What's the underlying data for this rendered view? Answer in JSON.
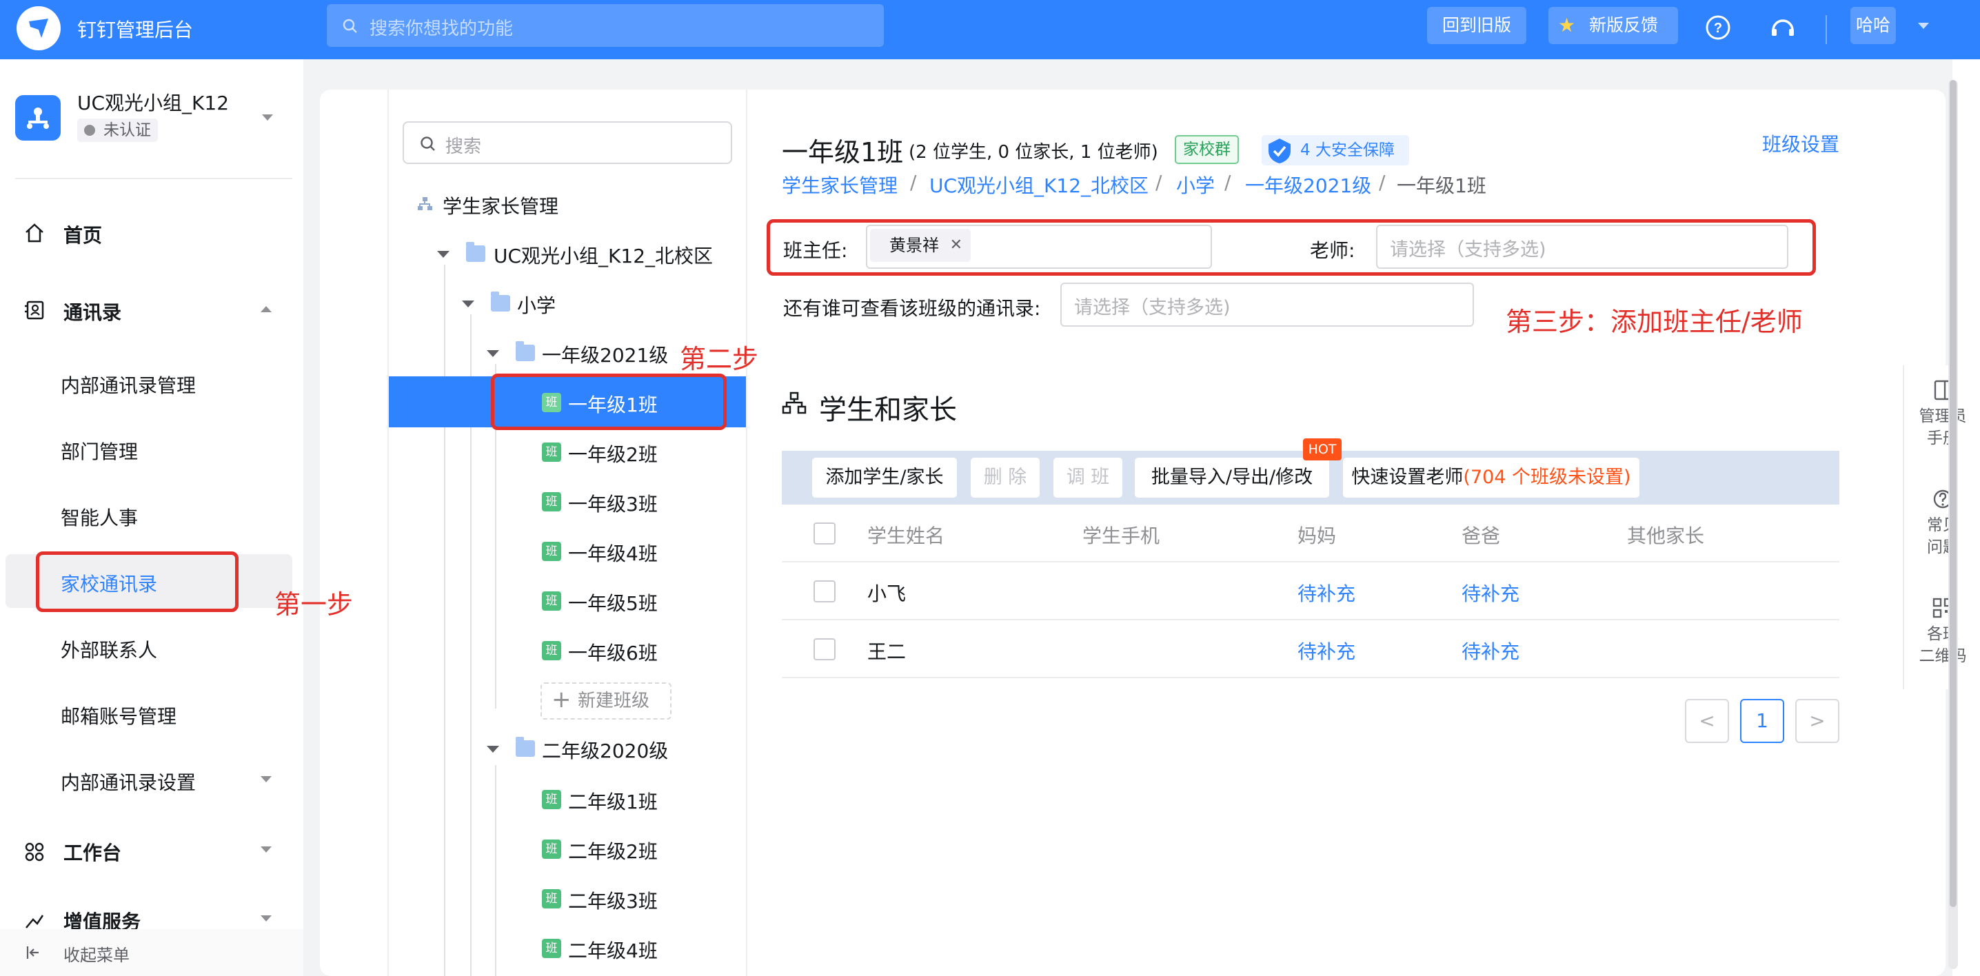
{
  "header": {
    "title": "钉钉管理后台",
    "search_placeholder": "搜索你想找的功能",
    "old_version": "回到旧版",
    "feedback": "新版反馈",
    "user": "哈哈"
  },
  "org": {
    "name": "UC观光小组_K12",
    "status": "未认证"
  },
  "sidebar": {
    "home": "首页",
    "contacts": "通讯录",
    "items": [
      "内部通讯录管理",
      "部门管理",
      "智能人事",
      "家校通讯录",
      "外部联系人",
      "邮箱账号管理",
      "内部通讯录设置"
    ],
    "workbench": "工作台",
    "value_added": "增值服务",
    "collapse": "收起菜单"
  },
  "annotations": {
    "step1": "第一步",
    "step2": "第二步",
    "step3": "第三步：添加班主任/老师"
  },
  "tree": {
    "search_placeholder": "搜索",
    "root": "学生家长管理",
    "campus": "UC观光小组_K12_北校区",
    "school": "小学",
    "grade1": "一年级2021级",
    "grade1_classes": [
      "一年级1班",
      "一年级2班",
      "一年级3班",
      "一年级4班",
      "一年级5班",
      "一年级6班"
    ],
    "new_class": "新建班级",
    "grade2": "二年级2020级",
    "grade2_classes": [
      "二年级1班",
      "二年级2班",
      "二年级3班",
      "二年级4班"
    ],
    "class_badge": "班"
  },
  "detail": {
    "title": "一年级1班",
    "subtitle": "(2 位学生, 0 位家长, 1 位老师)",
    "tag_group": "家校群",
    "tag_safety": "4 大安全保障",
    "settings": "班级设置",
    "breadcrumb": [
      "学生家长管理",
      "UC观光小组_K12_北校区",
      "小学",
      "一年级2021级",
      "一年级1班"
    ],
    "head_teacher_label": "班主任:",
    "head_teacher_value": "黄景祥",
    "teacher_label": "老师:",
    "teacher_placeholder": "请选择（支持多选)",
    "viewers_label": "还有谁可查看该班级的通讯录:",
    "viewers_placeholder": "请选择（支持多选)",
    "section_title": "学生和家长",
    "btn_add": "添加学生/家长",
    "btn_delete": "删 除",
    "btn_transfer": "调 班",
    "btn_batch": "批量导入/导出/修改",
    "hot": "HOT",
    "btn_quick": "快速设置老师",
    "btn_quick_note": "(704 个班级未设置)",
    "columns": [
      "学生姓名",
      "学生手机",
      "妈妈",
      "爸爸",
      "其他家长"
    ],
    "rows": [
      {
        "name": "小飞",
        "phone": "",
        "mom": "待补充",
        "dad": "待补充",
        "other": ""
      },
      {
        "name": "王二",
        "phone": "",
        "mom": "待补充",
        "dad": "待补充",
        "other": ""
      }
    ],
    "pagination": {
      "prev": "<",
      "current": "1",
      "next": ">"
    }
  },
  "right_panel": {
    "manual": [
      "管理员",
      "手册"
    ],
    "faq": [
      "常见",
      "问题"
    ],
    "qrcode": [
      "各班",
      "二维码"
    ]
  }
}
